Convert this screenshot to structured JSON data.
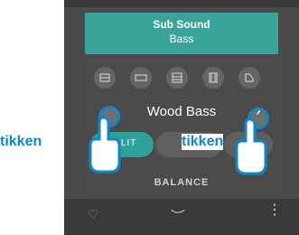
{
  "header": {
    "title": "Sub Sound",
    "subtitle": "Bass"
  },
  "sound": {
    "name": "Wood Bass"
  },
  "buttons": {
    "split_label": "SPLIT"
  },
  "balance": {
    "label": "BALANCE"
  },
  "annotations": {
    "tap1": "tikken",
    "tap2": "tikken"
  },
  "categories": [
    "piano-icon",
    "epiano-icon",
    "harpsichord-icon",
    "organ-icon",
    "grand-icon"
  ],
  "colors": {
    "accent": "#3aa39a",
    "annotation": "#0e88cc"
  }
}
